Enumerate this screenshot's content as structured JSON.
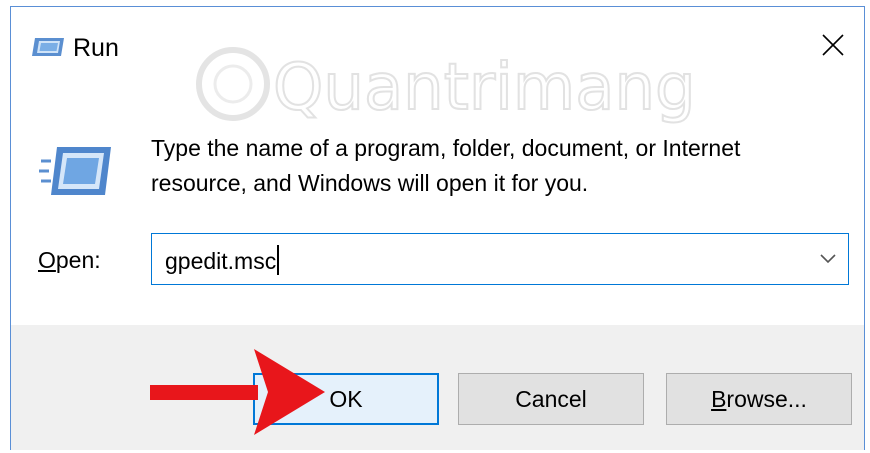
{
  "window": {
    "title": "Run",
    "title_icon": "run-icon"
  },
  "watermark": {
    "text": "Quantrimang"
  },
  "dialog": {
    "description_line1": "Type the name of a program, folder, document, or Internet",
    "description_line2": "resource, and Windows will open it for you.",
    "open_label_first": "O",
    "open_label_rest": "pen:",
    "open_value": "gpedit.msc"
  },
  "buttons": {
    "ok": "OK",
    "cancel": "Cancel",
    "browse_first": "B",
    "browse_rest": "rowse..."
  },
  "colors": {
    "accent": "#0078d7",
    "annotation_arrow": "#e8161b",
    "footer_bg": "#f0f0f0"
  }
}
